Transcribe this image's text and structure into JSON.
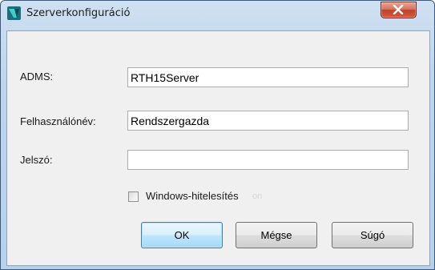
{
  "window": {
    "title": "Szerverkonfiguráció"
  },
  "form": {
    "adms_label": "ADMS:",
    "adms_value": "RTH15Server",
    "user_label": "Felhasználónév:",
    "user_value": "Rendszergazda",
    "password_label": "Jelszó:",
    "password_value": "",
    "windows_auth_label": "Windows-hitelesítés",
    "windows_auth_checked": false,
    "ghost_text": "on"
  },
  "buttons": {
    "ok": "OK",
    "cancel": "Mégse",
    "help": "Súgó"
  },
  "colors": {
    "app_icon": "#2aa8a0",
    "close": "#c24128",
    "default_button": "#3c7fb1"
  },
  "icons": {
    "app": "autodesk-vault-icon",
    "close": "close-icon",
    "checkbox": "checkbox-unchecked"
  }
}
